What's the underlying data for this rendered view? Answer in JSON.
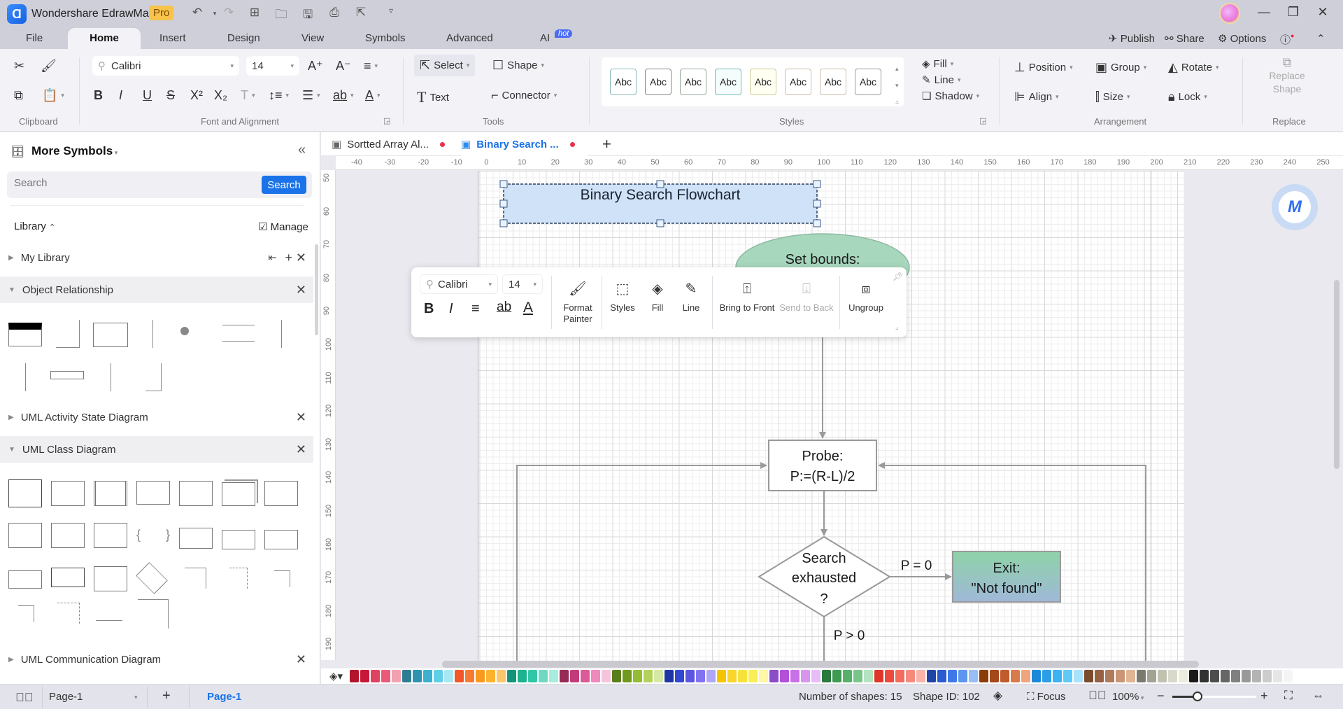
{
  "app": {
    "title": "Wondershare EdrawMax",
    "badge": "Pro",
    "quick_access": [
      "undo-icon",
      "redo-icon",
      "new-icon",
      "open-icon",
      "save-icon",
      "print-icon",
      "export-icon",
      "customize-icon"
    ]
  },
  "menu": {
    "tabs": [
      "File",
      "Home",
      "Insert",
      "Design",
      "View",
      "Symbols",
      "Advanced",
      "AI"
    ],
    "active": "Home",
    "ai_badge": "hot",
    "right": {
      "publish": "Publish",
      "share": "Share",
      "options": "Options"
    }
  },
  "ribbon": {
    "clipboard": {
      "label": "Clipboard"
    },
    "font": {
      "label": "Font and Alignment",
      "family": "Calibri",
      "size": "14"
    },
    "tools": {
      "label": "Tools",
      "select": "Select",
      "shape": "Shape",
      "text": "Text",
      "connector": "Connector"
    },
    "styles": {
      "label": "Styles",
      "swatches": [
        "Abc",
        "Abc",
        "Abc",
        "Abc",
        "Abc",
        "Abc",
        "Abc",
        "Abc"
      ],
      "fill": "Fill",
      "line": "Line",
      "shadow": "Shadow"
    },
    "arrangement": {
      "label": "Arrangement",
      "position": "Position",
      "group": "Group",
      "rotate": "Rotate",
      "align": "Align",
      "size": "Size",
      "lock": "Lock"
    },
    "replace": {
      "label": "Replace",
      "replace_shape_line1": "Replace",
      "replace_shape_line2": "Shape"
    }
  },
  "sidebar": {
    "title": "More Symbols",
    "search_placeholder": "Search",
    "search_button": "Search",
    "library_label": "Library",
    "manage_label": "Manage",
    "sections": [
      {
        "name": "My Library",
        "expanded": false
      },
      {
        "name": "Object Relationship",
        "expanded": true
      },
      {
        "name": "UML Activity State Diagram",
        "expanded": false
      },
      {
        "name": "UML Class Diagram",
        "expanded": true
      },
      {
        "name": "UML Communication Diagram",
        "expanded": false
      }
    ]
  },
  "documents": {
    "tabs": [
      {
        "title": "Sortted Array Al...",
        "unsaved": true,
        "active": false
      },
      {
        "title": "Binary Search ...",
        "unsaved": true,
        "active": true
      }
    ]
  },
  "rulers": {
    "horizontal": [
      "-40",
      "-30",
      "-20",
      "-10",
      "0",
      "10",
      "20",
      "30",
      "40",
      "50",
      "60",
      "70",
      "80",
      "90",
      "100",
      "110",
      "120",
      "130",
      "140",
      "150",
      "160",
      "170",
      "180",
      "190",
      "200",
      "210",
      "220",
      "230",
      "240",
      "250"
    ],
    "vertical": [
      "50",
      "60",
      "70",
      "80",
      "90",
      "100",
      "110",
      "120",
      "130",
      "140",
      "150",
      "160",
      "170",
      "180",
      "190"
    ]
  },
  "diagram": {
    "title_shape": "Binary Search Flowchart",
    "start_shape": "Set bounds:",
    "probe_line1": "Probe:",
    "probe_line2": "P:=(R-L)/2",
    "decision_line1": "Search",
    "decision_line2": "exhausted",
    "decision_line3": "?",
    "exit_line1": "Exit:",
    "exit_line2": "\"Not found\"",
    "label_p_eq_0": "P = 0",
    "label_p_gt_0": "P > 0"
  },
  "floating_toolbar": {
    "font_family": "Calibri",
    "font_size": "14",
    "format_painter_1": "Format",
    "format_painter_2": "Painter",
    "styles": "Styles",
    "fill": "Fill",
    "line": "Line",
    "bring_to_front": "Bring to Front",
    "send_to_back": "Send to Back",
    "ungroup": "Ungroup"
  },
  "palette": {
    "colors": [
      "#b3142b",
      "#c8183a",
      "#e04261",
      "#ea5a78",
      "#f3a1b1",
      "#2d7d93",
      "#2e93ae",
      "#3bb0cf",
      "#5ecfe6",
      "#a9e7f4",
      "#f2572a",
      "#f67c34",
      "#f89a1e",
      "#fbb22d",
      "#fcc66a",
      "#139478",
      "#1bb48f",
      "#2fc7a6",
      "#6fd8c0",
      "#a7ecdc",
      "#962b55",
      "#c23a78",
      "#da5b96",
      "#ef88bb",
      "#f4c4dc",
      "#5a7f1a",
      "#6f9a1e",
      "#94bd31",
      "#b2d25a",
      "#d5e8a4",
      "#1f35a6",
      "#3147d0",
      "#5b55e2",
      "#8173f0",
      "#aea6f6",
      "#f5c400",
      "#fad52a",
      "#f7e23c",
      "#f9ee55",
      "#fdf7a6",
      "#8b4cc7",
      "#b34fd9",
      "#c970e8",
      "#d795f0",
      "#e6bdf7",
      "#2a7a3c",
      "#3e9b53",
      "#56b06c",
      "#77c58a",
      "#b3e3c0",
      "#e0352b",
      "#ec4a3f",
      "#f36c5e",
      "#f6897c",
      "#f9b3a8",
      "#1e44a8",
      "#2a5bd1",
      "#3c78e8",
      "#5d95f1",
      "#98bdf7",
      "#8a3b08",
      "#a4471a",
      "#c05b2c",
      "#d97a4b",
      "#efa57e",
      "#1a8ad8",
      "#2b9ee8",
      "#3cb2f2",
      "#5fc9f7",
      "#a8e2fb",
      "#7b4b2b",
      "#966043",
      "#b07a5c",
      "#c99575",
      "#e0b594",
      "#7a7a70",
      "#a3a394",
      "#c2c2b1",
      "#d9d9cb",
      "#ececdf",
      "#1a1a1a",
      "#333333",
      "#4d4d4d",
      "#666666",
      "#808080",
      "#999999",
      "#b3b3b3",
      "#cccccc",
      "#e6e6e6",
      "#f5f5f5"
    ]
  },
  "status": {
    "page_selector": "Page-1",
    "page_tab": "Page-1",
    "shape_count": "Number of shapes: 15",
    "shape_id": "Shape ID: 102",
    "focus": "Focus",
    "zoom": "100%",
    "zoom_fraction": 0.3
  },
  "colors": {
    "accent": "#1a73e8",
    "title_fill": "#cfe2f8",
    "start_fill": "#a7d7bd",
    "exit_fill_top": "#8fd3a8",
    "exit_fill_bottom": "#9fb8d8"
  }
}
